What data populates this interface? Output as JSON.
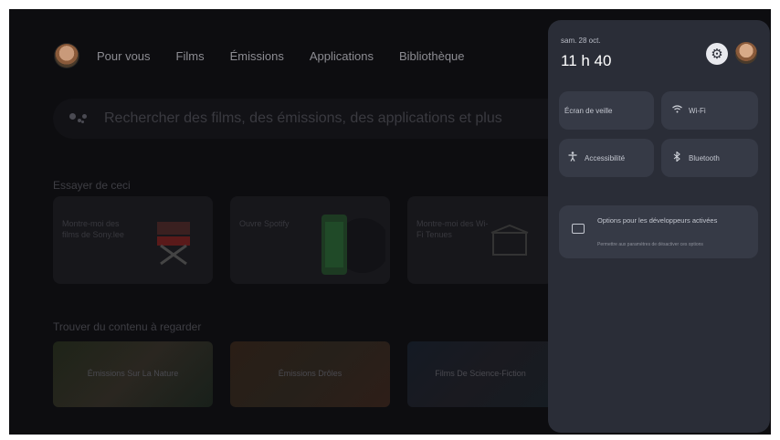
{
  "nav": {
    "items": [
      "Pour vous",
      "Films",
      "Émissions",
      "Applications",
      "Bibliothèque"
    ]
  },
  "search": {
    "placeholder": "Rechercher des films, des émissions, des applications et plus"
  },
  "sections": {
    "try": "Essayer de ceci",
    "find": "Trouver du contenu à regarder"
  },
  "cards": [
    {
      "label": "Montre-moi des films de Sony.lee"
    },
    {
      "label": "Ouvre Spotify"
    },
    {
      "label": "Montre-moi des Wi-Fi Tenues"
    }
  ],
  "thumbs": [
    {
      "label": "Émissions Sur La Nature"
    },
    {
      "label": "Émissions Drôles"
    },
    {
      "label": "Films De Science-Fiction"
    }
  ],
  "panel": {
    "date": "sam. 28 oct.",
    "time": "11 h 40",
    "tiles": {
      "screensaver": "Écran de veille",
      "wifi": "Wi-Fi",
      "accessibility": "Accessibilité",
      "bluetooth": "Bluetooth"
    },
    "developer": {
      "title": "Options pour les développeurs activées",
      "subtitle": "Permettre aux paramètres de désactiver ces options"
    }
  },
  "icons": {
    "settings": "gear-icon",
    "wifi": "wifi-icon",
    "accessibility": "accessibility-icon",
    "bluetooth": "bluetooth-icon",
    "developer": "developer-options-icon"
  },
  "colors": {
    "panel_bg": "#2a2d37",
    "tile_bg": "#363a46",
    "screen_bg": "#0d0d10"
  }
}
